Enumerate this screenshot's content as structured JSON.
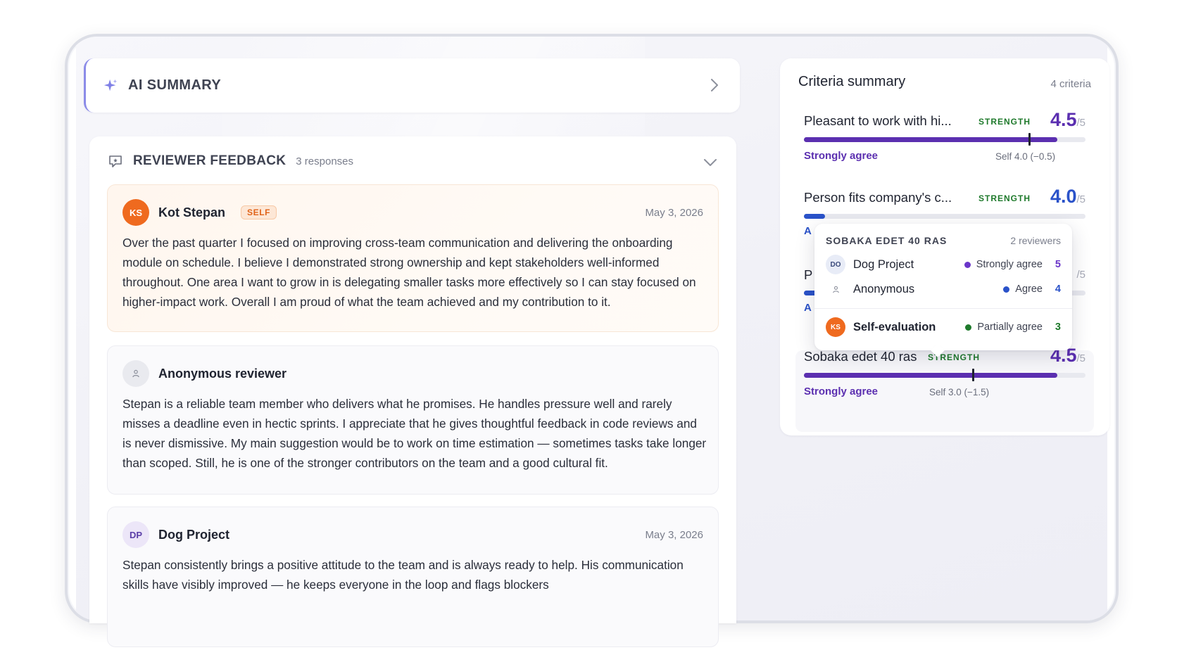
{
  "ai_summary": {
    "title": "AI SUMMARY"
  },
  "feedback": {
    "title_a": "REVIEWER ",
    "title_b": "FEEDBACK",
    "count": "3 responses",
    "reviews": [
      {
        "initials": "KS",
        "name": "Kot Stepan",
        "badge": "SELF",
        "date": "May 3, 2026",
        "text": "Over the past quarter I focused on improving cross-team communication and delivering the onboarding module on schedule. I believe I demonstrated strong ownership and kept stakeholders well-informed throughout. One area I want to grow in is delegating smaller tasks more effectively so I can stay focused on higher-impact work. Overall I am proud of what the team achieved and my contribution to it."
      },
      {
        "initials": "",
        "name": "Anonymous reviewer",
        "date": "",
        "text": "Stepan is a reliable team member who delivers what he promises. He handles pressure well and rarely misses a deadline even in hectic sprints. I appreciate that he gives thoughtful feedback in code reviews and is never dismissive. My main suggestion would be to work on time estimation — sometimes tasks take longer than scoped. Still, he is one of the stronger contributors on the team and a good cultural fit."
      },
      {
        "initials": "DP",
        "name": "Dog Project",
        "date": "May 3, 2026",
        "text": "Stepan consistently brings a positive attitude to the team and is always ready to help. His communication skills have visibly improved — he keeps everyone in the loop and flags blockers"
      }
    ]
  },
  "criteria": {
    "title": "Criteria summary",
    "count": "4 criteria",
    "items": [
      {
        "name": "Pleasant to work with hi...",
        "tag": "STRENGTH",
        "score": "4.5",
        "den": "/5",
        "score_color": "#5b2fb0",
        "fill_fraction": 0.9,
        "fill_color": "#5b2fb0",
        "self_fraction": 0.8,
        "agree": "Strongly agree",
        "self": "Self 4.0 (−0.5)"
      },
      {
        "name": "Person fits company's c...",
        "tag": "STRENGTH",
        "score": "4.0",
        "den": "/5",
        "score_color": "#2a52c9",
        "cut_agree": "A",
        "fill_color": "#2a52c9"
      },
      {
        "name": "P",
        "den": "/5",
        "cut_agree": "A",
        "fill_color": "#2a52c9"
      },
      {
        "name": "Sobaka edet 40 ras",
        "tag": "STRENGTH",
        "score": "4.5",
        "den": "/5",
        "score_color": "#5b2fb0",
        "fill_fraction": 0.9,
        "fill_color": "#5b2fb0",
        "self_fraction": 0.6,
        "agree": "Strongly agree",
        "self": "Self 3.0 (−1.5)"
      }
    ]
  },
  "popover": {
    "title": "SOBAKA EDET 40 RAS",
    "sub": "2 reviewers",
    "rows": [
      {
        "initials": "DO",
        "name": "Dog Project",
        "label": "Strongly agree",
        "value": "5",
        "color": "#6a36c9"
      },
      {
        "initials": "",
        "name": "Anonymous",
        "label": "Agree",
        "value": "4",
        "color": "#2a52c9"
      },
      {
        "initials": "KS",
        "name": "Self-evaluation",
        "label": "Partially agree",
        "value": "3",
        "color": "#1f7a2c"
      }
    ]
  }
}
